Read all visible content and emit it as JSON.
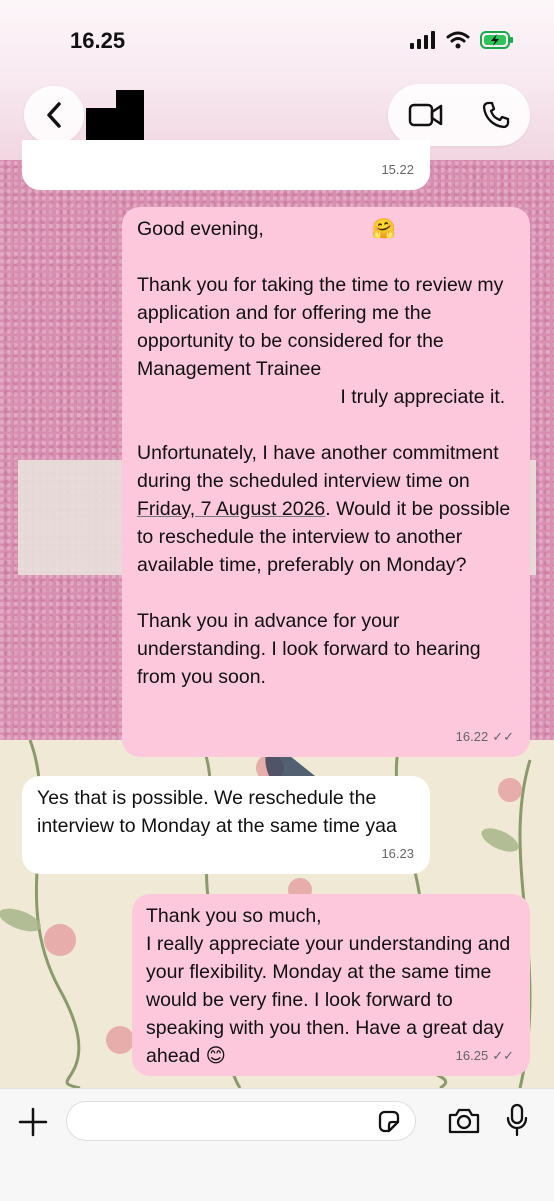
{
  "status_bar": {
    "time": "16.25"
  },
  "header": {
    "contact_name": "",
    "back_label": "<"
  },
  "messages": [
    {
      "direction": "incoming",
      "text": "",
      "time": "15.22"
    },
    {
      "direction": "outgoing",
      "greeting": "Good evening,",
      "emoji": "🤗",
      "p1_a": "Thank you for taking the time to review my application and for offering me the opportunity to be considered for the Management Trainee",
      "p1_b": "I truly appreciate it.",
      "p2_a": "Unfortunately, I have another commitment during the scheduled interview time on ",
      "p2_date": "Friday, 7 August 2026",
      "p2_b": ". Would it be possible to reschedule the interview to another available time, preferably on Monday?",
      "p3": "Thank you in advance for your understanding. I look forward to hearing from you soon.",
      "time": "16.22"
    },
    {
      "direction": "incoming",
      "text": "Yes that is possible. We reschedule the interview to Monday at the same time yaa",
      "time": "16.23"
    },
    {
      "direction": "outgoing",
      "text": "Thank you so much,\nI really appreciate your understanding and your flexibility. Monday at the same time would be very fine. I look forward to speaking with you then. Have a great day ahead",
      "emoji": "😊",
      "time": "16.25"
    }
  ],
  "composer": {
    "placeholder": ""
  },
  "colors": {
    "outgoing_bubble": "#fdc8dc",
    "incoming_bubble": "#ffffff",
    "wallpaper_pink": "#d88fb1",
    "tick_color": "#666666"
  },
  "icons": [
    "back-chevron-icon",
    "video-call-icon",
    "phone-icon",
    "plus-icon",
    "sticker-icon",
    "camera-icon",
    "mic-icon",
    "signal-icon",
    "wifi-icon",
    "battery-icon"
  ]
}
